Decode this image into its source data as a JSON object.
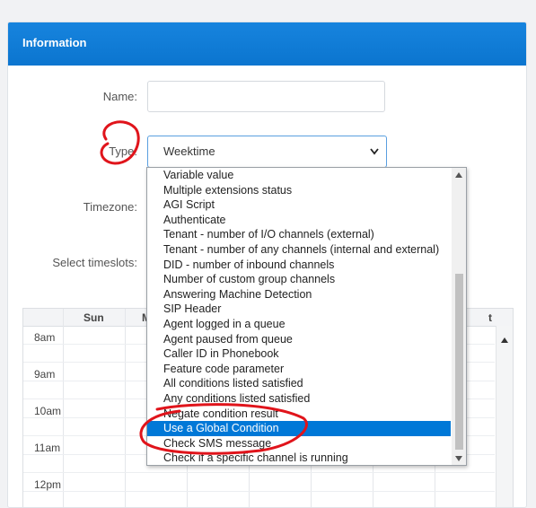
{
  "panel": {
    "title": "Information"
  },
  "form": {
    "name_label": "Name:",
    "name_value": "",
    "type_label": "Type:",
    "type_value": "Weektime",
    "timezone_label": "Timezone:",
    "timeslots_label": "Select timeslots:"
  },
  "grid": {
    "day_headers": [
      "Sun",
      "M",
      "t"
    ],
    "times": [
      "8am",
      "9am",
      "10am",
      "11am",
      "12pm"
    ]
  },
  "dropdown": {
    "options": [
      "Variable value",
      "Multiple extensions status",
      "AGI Script",
      "Authenticate",
      "Tenant - number of I/O channels (external)",
      "Tenant - number of any channels (internal and external)",
      "DID - number of inbound channels",
      "Number of custom group channels",
      "Answering Machine Detection",
      "SIP Header",
      "Agent logged in a queue",
      "Agent paused from queue",
      "Caller ID in Phonebook",
      "Feature code parameter",
      "All conditions listed satisfied",
      "Any conditions listed satisfied",
      "Negate condition result",
      "Use a Global Condition",
      "Check SMS message",
      "Check if a specific channel is running"
    ],
    "selected": "Use a Global Condition",
    "selected_index": 17
  },
  "colors": {
    "header": "#0f7fd8",
    "selection": "#0078d7",
    "annotation": "#e0141b"
  }
}
